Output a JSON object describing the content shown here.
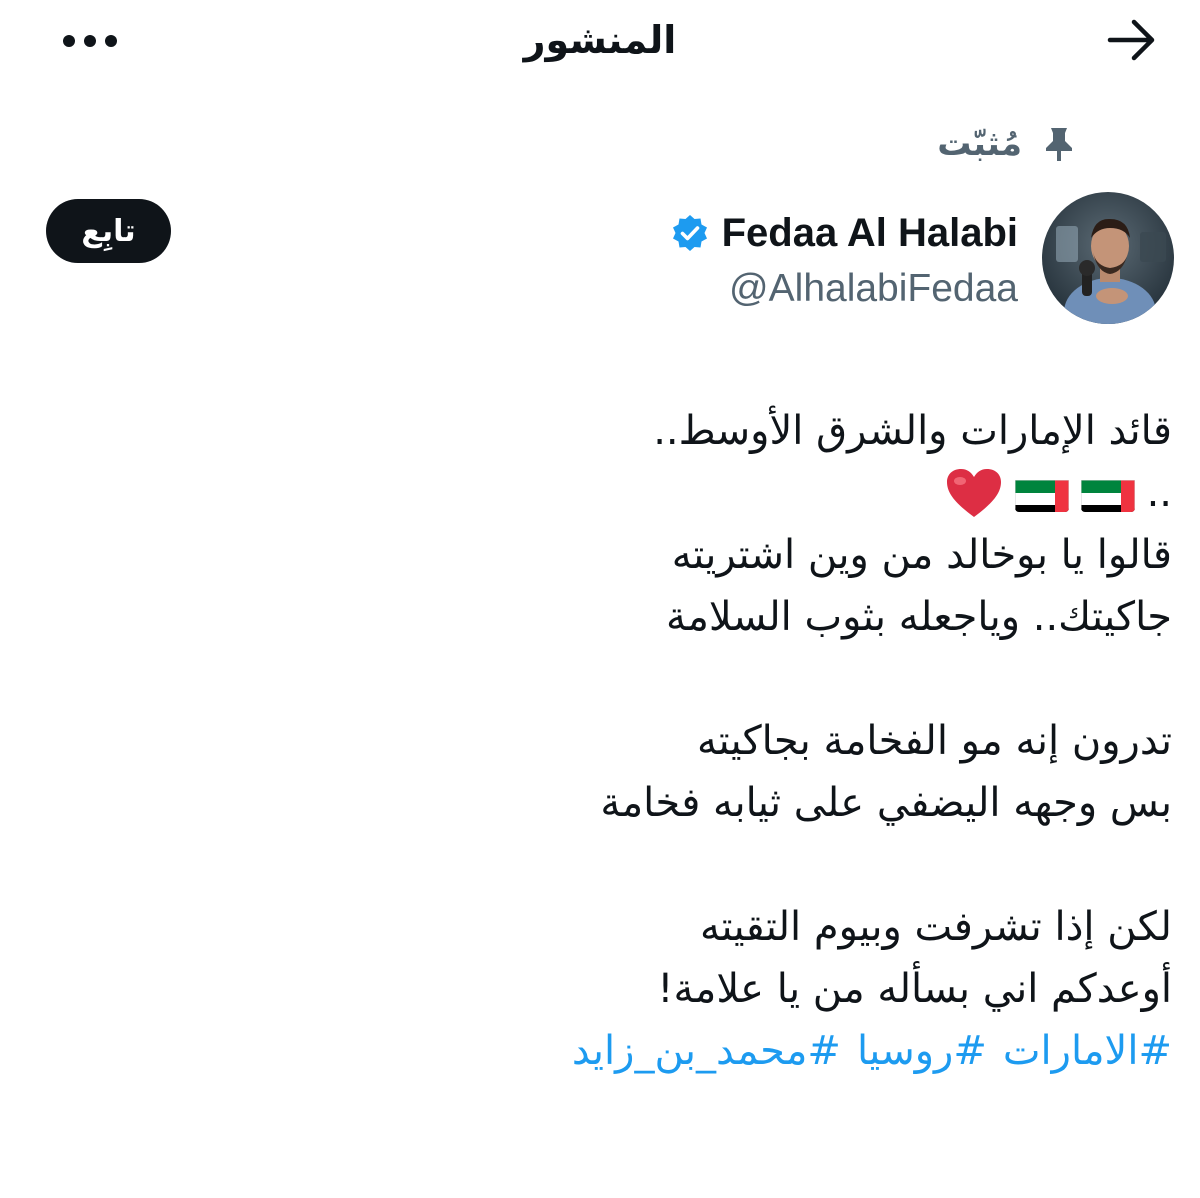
{
  "header": {
    "title": "المنشور",
    "back_icon": "arrow-right-icon",
    "more_icon": "more-horizontal-icon"
  },
  "pinned": {
    "label": "مُثبّت",
    "icon": "pin-icon"
  },
  "author": {
    "name": "Fedaa Al Halabi",
    "handle": "@AlhalabiFedaa",
    "verified_icon": "verified-badge-icon",
    "avatar_icon": "avatar"
  },
  "follow_button": {
    "label": "تابِع"
  },
  "post": {
    "lines": [
      "قائد الإمارات والشرق الأوسط..",
      "..",
      "قالوا يا بوخالد من وين اشتريته",
      "جاكيتك.. وياجعله بثوب السلامة",
      "",
      "تدرون إنه مو الفخامة بجاكيته",
      "بس وجهه اليضفي على ثيابه فخامة",
      "",
      "لكن إذا تشرفت وبيوم التقيته",
      "أوعدكم اني بسأله من يا علامة!"
    ],
    "emojis": [
      "uae-flag",
      "uae-flag",
      "red-heart"
    ],
    "hashtags": [
      "#الامارات",
      "#روسيا",
      "#محمد_بن_زايد"
    ]
  },
  "colors": {
    "text_primary": "#0f1419",
    "text_secondary": "#536471",
    "link": "#1d9bf0",
    "verified": "#1d9bf0",
    "follow_bg": "#0f1419"
  }
}
